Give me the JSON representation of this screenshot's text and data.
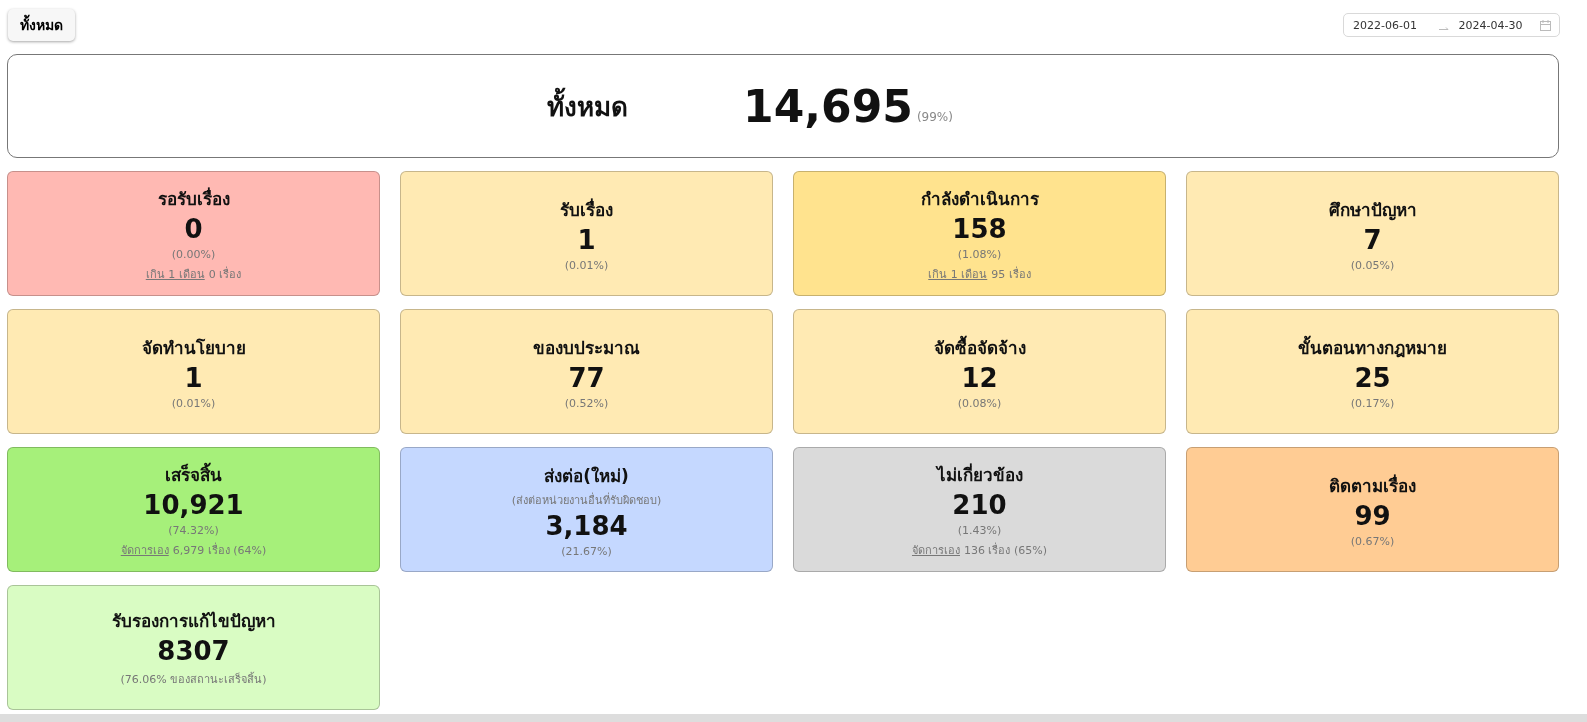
{
  "filter_button": "ทั้งหมด",
  "date_range": {
    "start": "2022-06-01",
    "end": "2024-04-30"
  },
  "total": {
    "label": "ทั้งหมด",
    "value": "14,695",
    "percent": "(99%)"
  },
  "cards": [
    {
      "title": "รอรับเรื่อง",
      "value": "0",
      "percent": "(0.00%)",
      "color": "#ffb9b3",
      "note": {
        "link": "เกิน 1 เดือน",
        "text": "0 เรื่อง"
      }
    },
    {
      "title": "รับเรื่อง",
      "value": "1",
      "percent": "(0.01%)",
      "color": "#ffeab3"
    },
    {
      "title": "กำลังดำเนินการ",
      "value": "158",
      "percent": "(1.08%)",
      "color": "#ffe38e",
      "note": {
        "link": "เกิน 1 เดือน",
        "text": "95 เรื่อง"
      }
    },
    {
      "title": "ศึกษาปัญหา",
      "value": "7",
      "percent": "(0.05%)",
      "color": "#ffeab3"
    },
    {
      "title": "จัดทำนโยบาย",
      "value": "1",
      "percent": "(0.01%)",
      "color": "#ffeab3"
    },
    {
      "title": "ของบประมาณ",
      "value": "77",
      "percent": "(0.52%)",
      "color": "#ffeab3"
    },
    {
      "title": "จัดซื้อจัดจ้าง",
      "value": "12",
      "percent": "(0.08%)",
      "color": "#ffeab3"
    },
    {
      "title": "ขั้นตอนทางกฎหมาย",
      "value": "25",
      "percent": "(0.17%)",
      "color": "#ffeab3"
    },
    {
      "title": "เสร็จสิ้น",
      "value": "10,921",
      "percent": "(74.32%)",
      "color": "#a6f07a",
      "note": {
        "link": "จัดการเอง",
        "text": "6,979 เรื่อง (64%)"
      }
    },
    {
      "title": "ส่งต่อ(ใหม่)",
      "subtitle": "(ส่งต่อหน่วยงานอื่นที่รับผิดชอบ)",
      "value": "3,184",
      "percent": "(21.67%)",
      "color": "#c5d8ff"
    },
    {
      "title": "ไม่เกี่ยวข้อง",
      "value": "210",
      "percent": "(1.43%)",
      "color": "#dadada",
      "note": {
        "link": "จัดการเอง",
        "text": "136 เรื่อง (65%)"
      }
    },
    {
      "title": "ติดตามเรื่อง",
      "value": "99",
      "percent": "(0.67%)",
      "color": "#ffcc94"
    },
    {
      "title": "รับรองการแก้ไขปัญหา",
      "value": "8307",
      "percent": "(76.06% ของสถานะเสร็จสิ้น)",
      "color": "#d9fcc3"
    }
  ]
}
